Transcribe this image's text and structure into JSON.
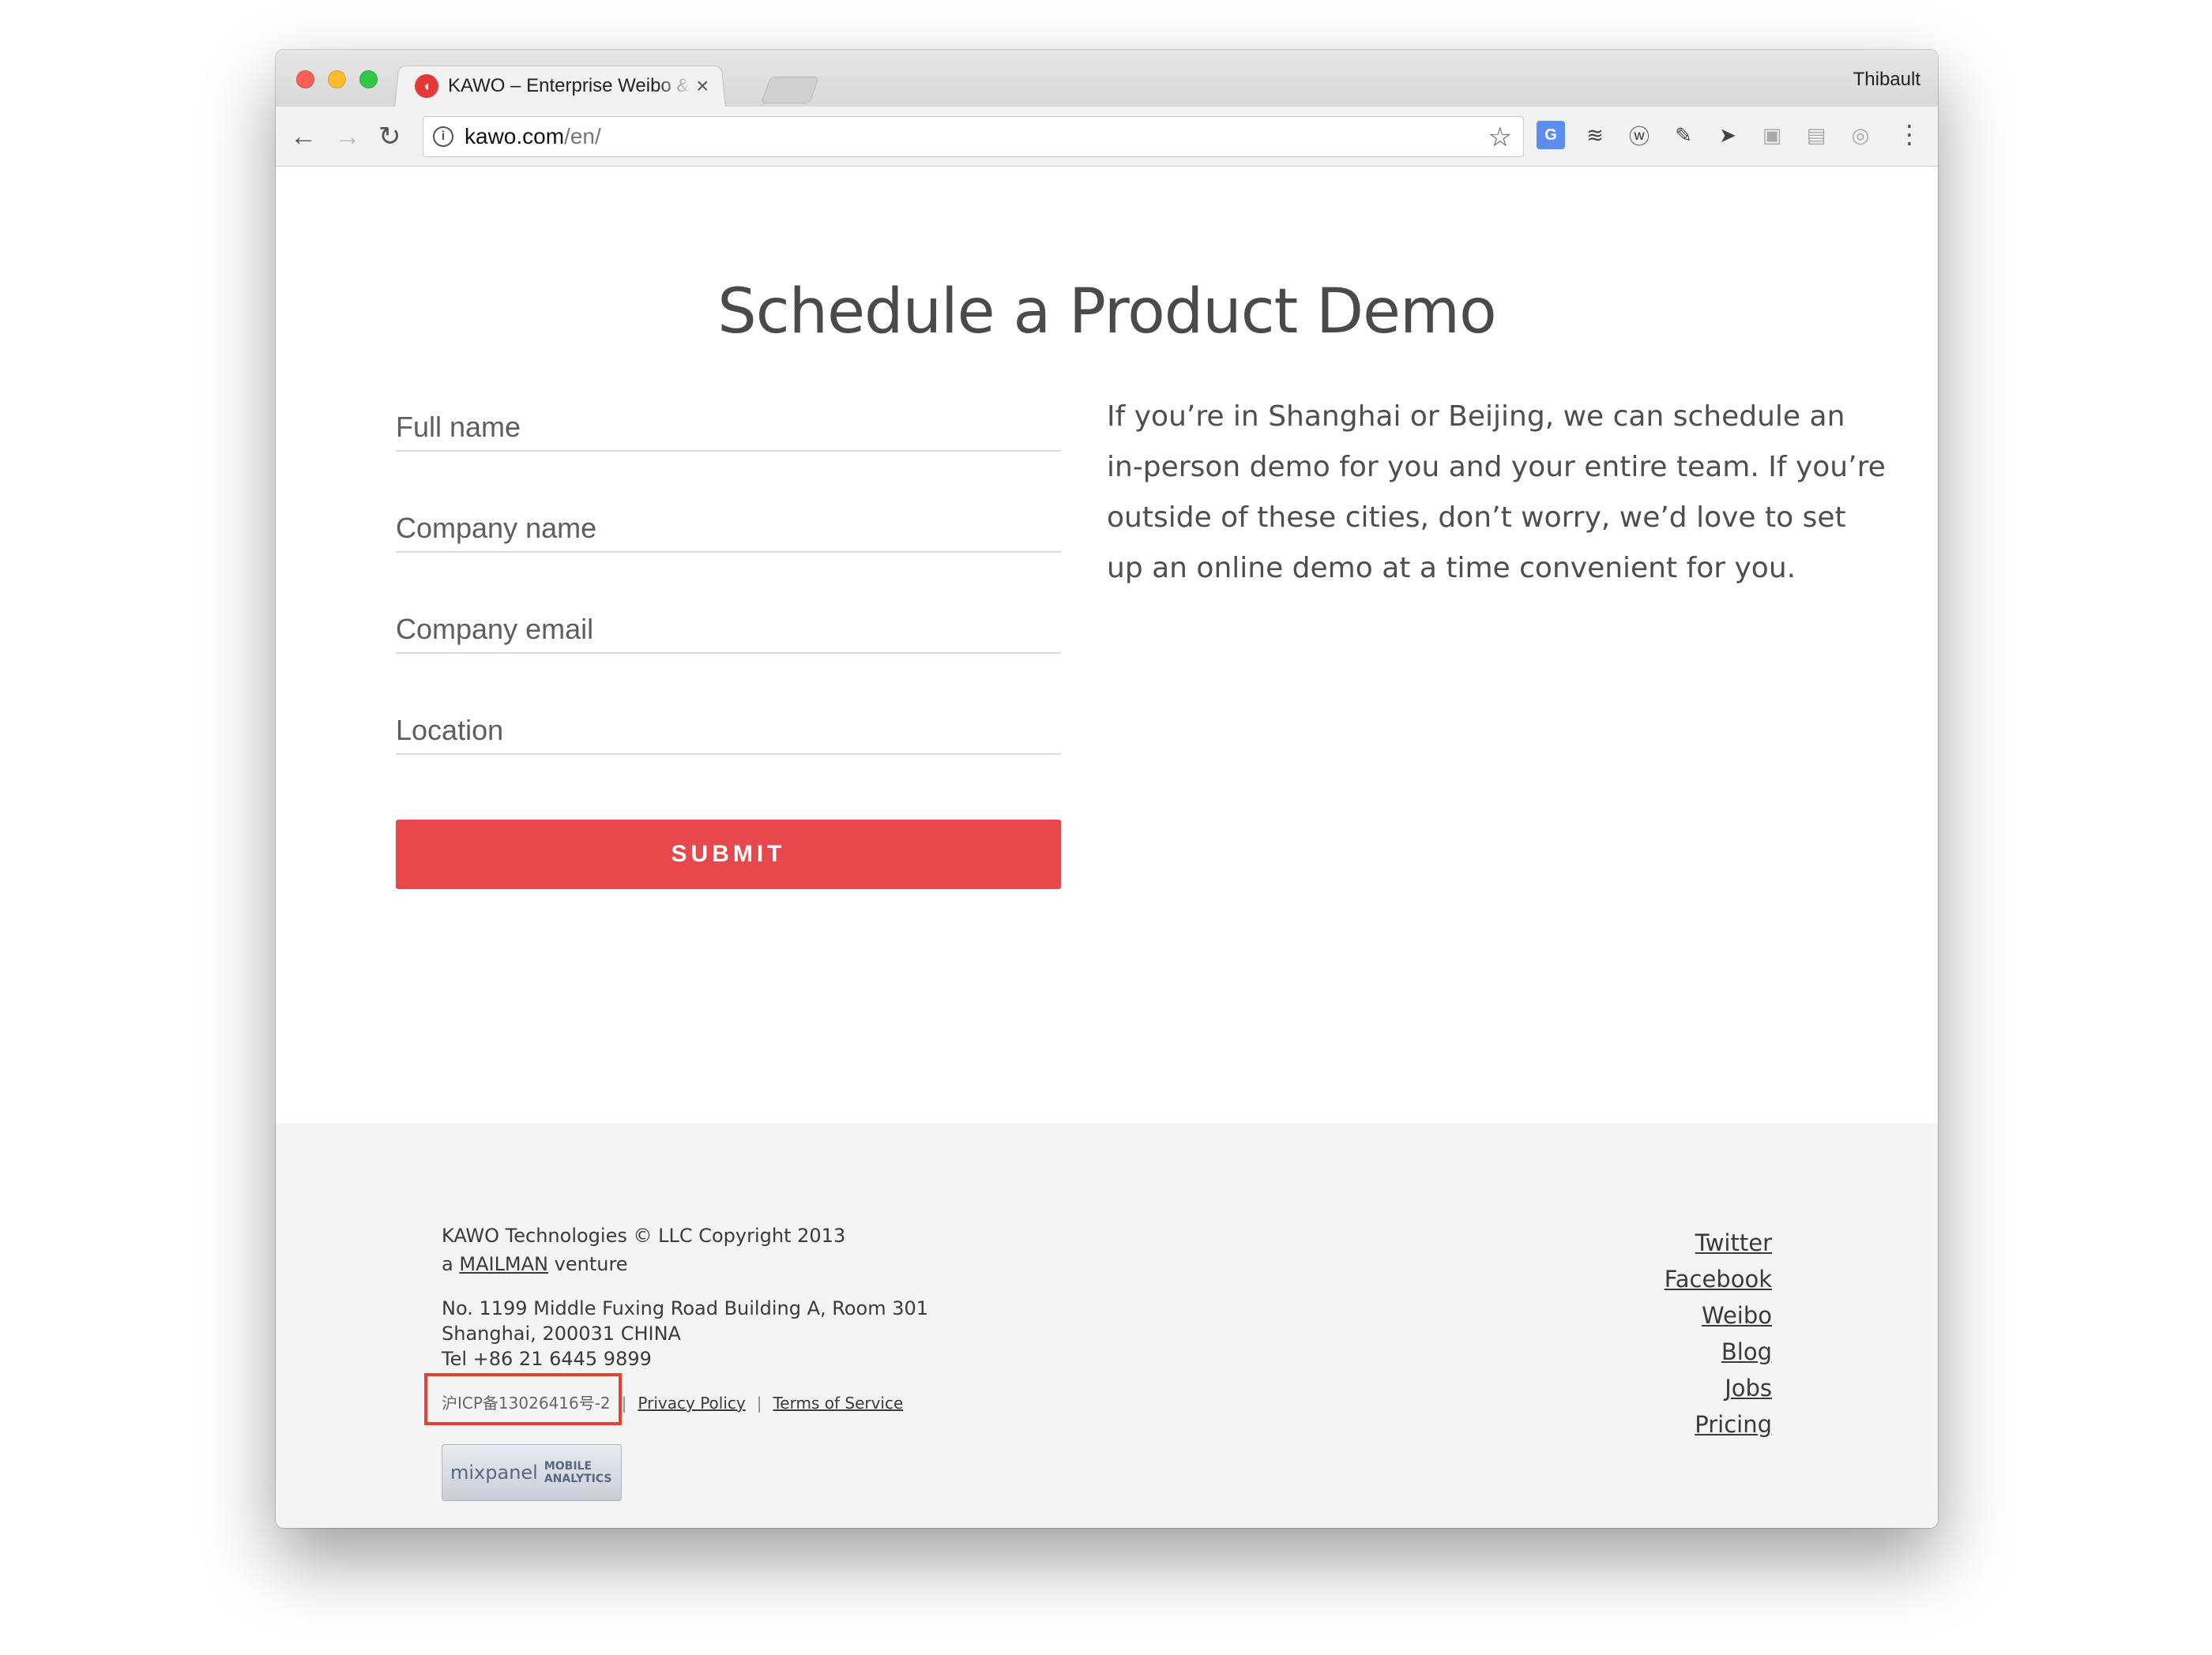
{
  "browser": {
    "tab_title": "KAWO – Enterprise Weibo & WeChat",
    "tab_close": "×",
    "profile_name": "Thibault",
    "url_host": "kawo.com",
    "url_path": "/en/",
    "icons": {
      "back": "arrow-left",
      "forward": "arrow-right",
      "reload": "reload",
      "info": "info",
      "star": "star",
      "menu": "more-vertical"
    },
    "extensions": [
      "translate",
      "buffer",
      "wordpress",
      "eyedropper",
      "cursor",
      "evernote",
      "screenshot",
      "misc"
    ]
  },
  "page": {
    "title": "Schedule a Product Demo",
    "form": {
      "full_name_placeholder": "Full name",
      "company_name_placeholder": "Company name",
      "company_email_placeholder": "Company email",
      "location_placeholder": "Location",
      "submit_label": "SUBMIT"
    },
    "intro": "If you’re in Shanghai or Beijing, we can schedule an in-person demo for you and your entire team. If you’re outside of these cities, don’t worry, we’d love to set up an online demo at a time convenient for you."
  },
  "footer": {
    "copyright": "KAWO Technologies © LLC Copyright 2013",
    "venture_prefix": "a",
    "venture_link": "MAILMAN",
    "venture_suffix": "venture",
    "address_line1": "No. 1199 Middle Fuxing Road Building A, Room 301",
    "address_line2": "Shanghai, 200031 CHINA",
    "phone": "Tel +86 21 6445 9899",
    "icp": "沪ICP备13026416号-2",
    "separator": "|",
    "privacy": "Privacy Policy",
    "terms": "Terms of Service",
    "mixpanel_brand": "mixpanel",
    "mixpanel_line1": "MOBILE",
    "mixpanel_line2": "ANALYTICS",
    "links": [
      "Twitter",
      "Facebook",
      "Weibo",
      "Blog",
      "Jobs",
      "Pricing"
    ],
    "highlight_color": "#e0442e"
  },
  "colors": {
    "accent": "#e8474b",
    "text": "#4e4e4e",
    "footer_bg": "#f4f4f4"
  }
}
